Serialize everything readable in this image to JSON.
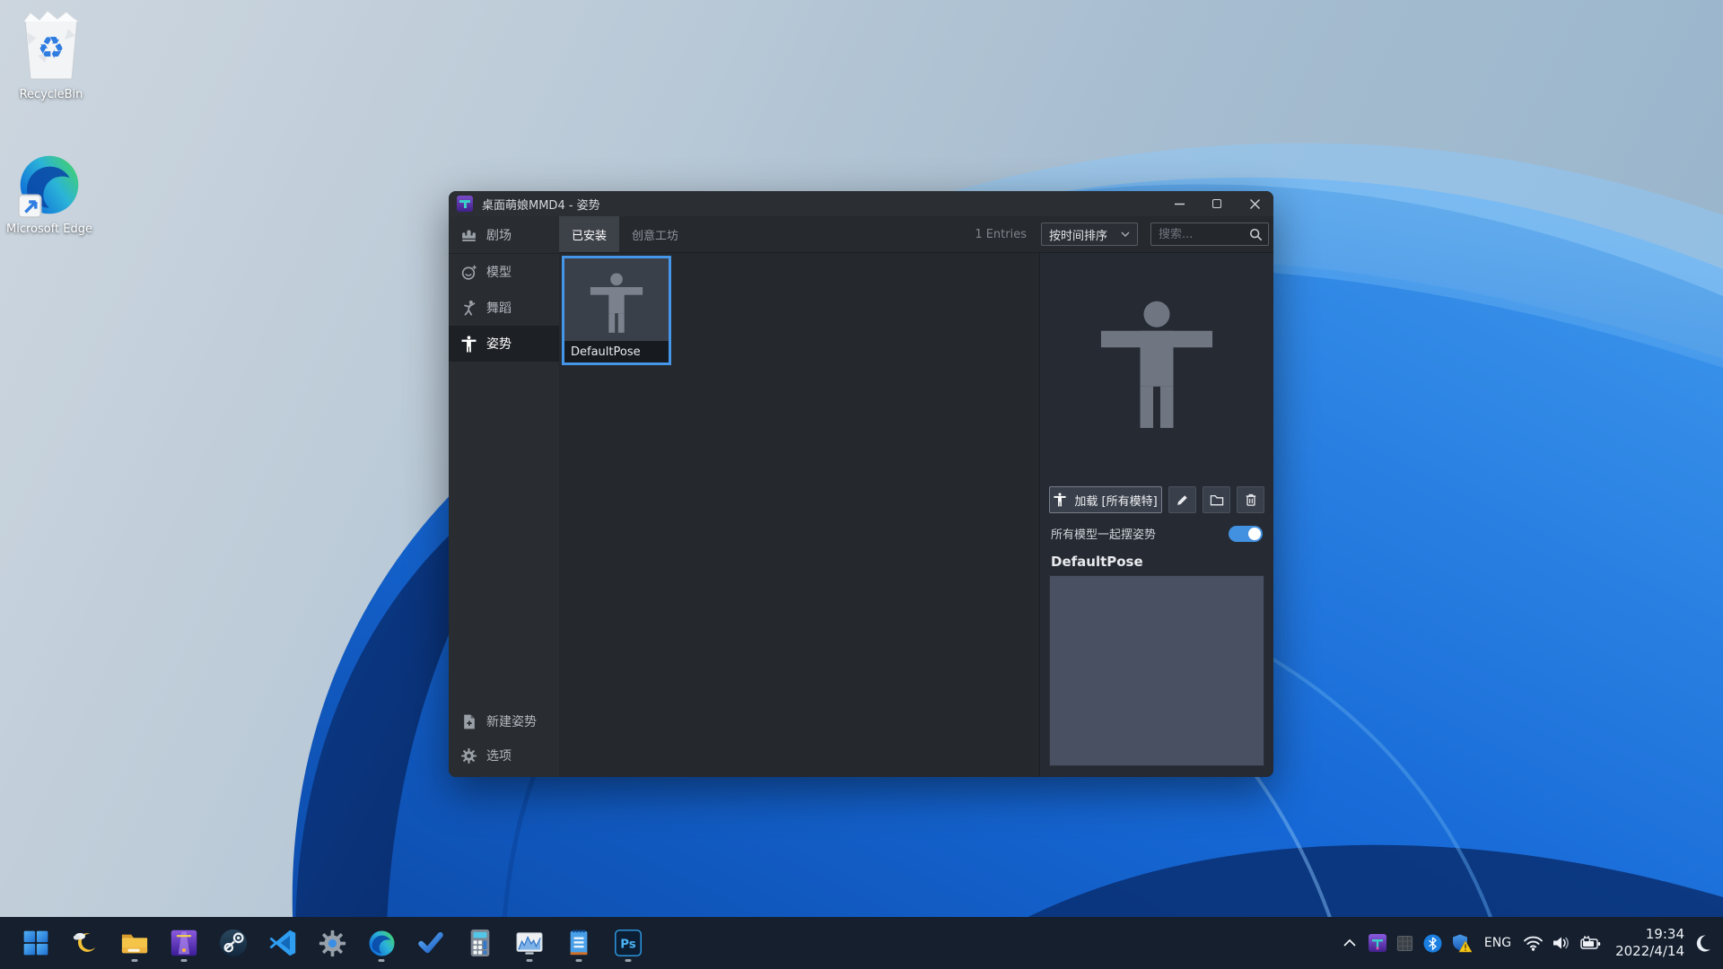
{
  "colors": {
    "accent": "#4596e8",
    "selection_border": "#4596e8",
    "toggle_on": "#4290e0",
    "window_bg": "#25282d",
    "sidebar_bg": "#292c30",
    "right_panel_bg": "#262a32",
    "taskbar_bg": "#151f2e"
  },
  "desktop": {
    "icons": [
      {
        "name": "recycle-bin",
        "label": "RecycleBin"
      },
      {
        "name": "microsoft-edge-shortcut",
        "label": "Microsoft Edge"
      }
    ]
  },
  "window": {
    "title": "桌面萌娘MMD4 - 姿势",
    "controls": [
      "minimize",
      "maximize",
      "close"
    ],
    "sidebar": {
      "items": [
        {
          "icon": "theater-icon",
          "label": "剧场",
          "selected": false
        },
        {
          "icon": "model-face-icon",
          "label": "模型",
          "selected": false
        },
        {
          "icon": "dance-icon",
          "label": "舞蹈",
          "selected": false
        },
        {
          "icon": "pose-person-icon",
          "label": "姿势",
          "selected": true
        }
      ],
      "bottom_items": [
        {
          "icon": "new-pose-file-icon",
          "label": "新建姿势"
        },
        {
          "icon": "gear-icon",
          "label": "选项"
        }
      ]
    },
    "toolbar": {
      "tabs": [
        {
          "label": "已安装",
          "selected": true
        },
        {
          "label": "创意工坊",
          "selected": false
        }
      ],
      "entries_count": "1 Entries",
      "sort_dropdown": {
        "selected": "按时间排序"
      },
      "search": {
        "placeholder": "搜索..."
      }
    },
    "grid": {
      "items": [
        {
          "label": "DefaultPose",
          "icon": "tpose-person-icon",
          "selected": true
        }
      ]
    },
    "panel": {
      "preview_icon": "tpose-person-icon",
      "load_button_label": "加载 [所有模特]",
      "action_icons": [
        "edit-pencil-icon",
        "open-folder-icon",
        "delete-trash-icon"
      ],
      "toggle_label": "所有模型一起摆姿势",
      "toggle_on": true,
      "pose_title": "DefaultPose"
    }
  },
  "taskbar": {
    "pinned": [
      {
        "name": "start",
        "running": false
      },
      {
        "name": "widgets-weather-moon",
        "running": false
      },
      {
        "name": "file-explorer",
        "running": true
      },
      {
        "name": "mmd-app",
        "running": true
      },
      {
        "name": "steam",
        "running": false
      },
      {
        "name": "vscode",
        "running": false
      },
      {
        "name": "settings",
        "running": false
      },
      {
        "name": "edge",
        "running": true
      },
      {
        "name": "todo",
        "running": false
      },
      {
        "name": "calculator",
        "running": false
      },
      {
        "name": "task-manager",
        "running": true
      },
      {
        "name": "notepad",
        "running": true
      },
      {
        "name": "photoshop",
        "running": true
      }
    ]
  },
  "tray": {
    "language": "ENG",
    "time": "19:34",
    "date": "2022/4/14",
    "icons": [
      "chevron-up",
      "mmd-app",
      "tablet-grid",
      "bluetooth",
      "security-shield-warning",
      "wifi",
      "volume",
      "battery-charging",
      "night-mode-moon"
    ]
  }
}
